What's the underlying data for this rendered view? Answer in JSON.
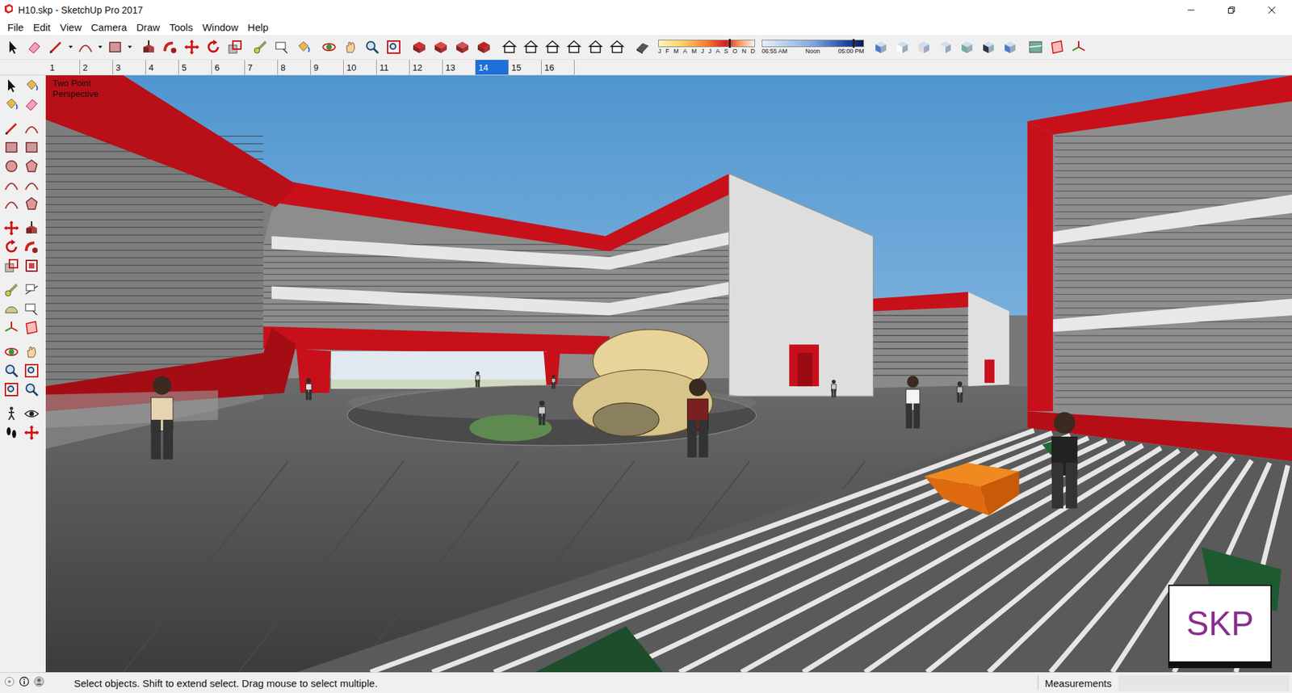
{
  "window": {
    "title": "H10.skp - SketchUp Pro 2017"
  },
  "menu": [
    "File",
    "Edit",
    "View",
    "Camera",
    "Draw",
    "Tools",
    "Window",
    "Help"
  ],
  "shadow_settings": {
    "months": [
      "J",
      "F",
      "M",
      "A",
      "M",
      "J",
      "J",
      "A",
      "S",
      "O",
      "N",
      "D"
    ],
    "date_level": 0.74,
    "times": [
      "06:55 AM",
      "Noon",
      "05:00 PM"
    ],
    "time_level": 0.9
  },
  "scene_tabs": [
    {
      "label": "1",
      "selected": false
    },
    {
      "label": "2",
      "selected": false
    },
    {
      "label": "3",
      "selected": false
    },
    {
      "label": "4",
      "selected": false
    },
    {
      "label": "5",
      "selected": false
    },
    {
      "label": "6",
      "selected": false
    },
    {
      "label": "7",
      "selected": false
    },
    {
      "label": "8",
      "selected": false
    },
    {
      "label": "9",
      "selected": false
    },
    {
      "label": "10",
      "selected": false
    },
    {
      "label": "11",
      "selected": false
    },
    {
      "label": "12",
      "selected": false
    },
    {
      "label": "13",
      "selected": false
    },
    {
      "label": "14",
      "selected": true
    },
    {
      "label": "15",
      "selected": false
    },
    {
      "label": "16",
      "selected": false
    }
  ],
  "viewport": {
    "camera_label": "Two Point Perspective",
    "watermark": "SKP"
  },
  "status_bar": {
    "message": "Select objects. Shift to extend select. Drag mouse to select multiple.",
    "measurements_label": "Measurements"
  }
}
